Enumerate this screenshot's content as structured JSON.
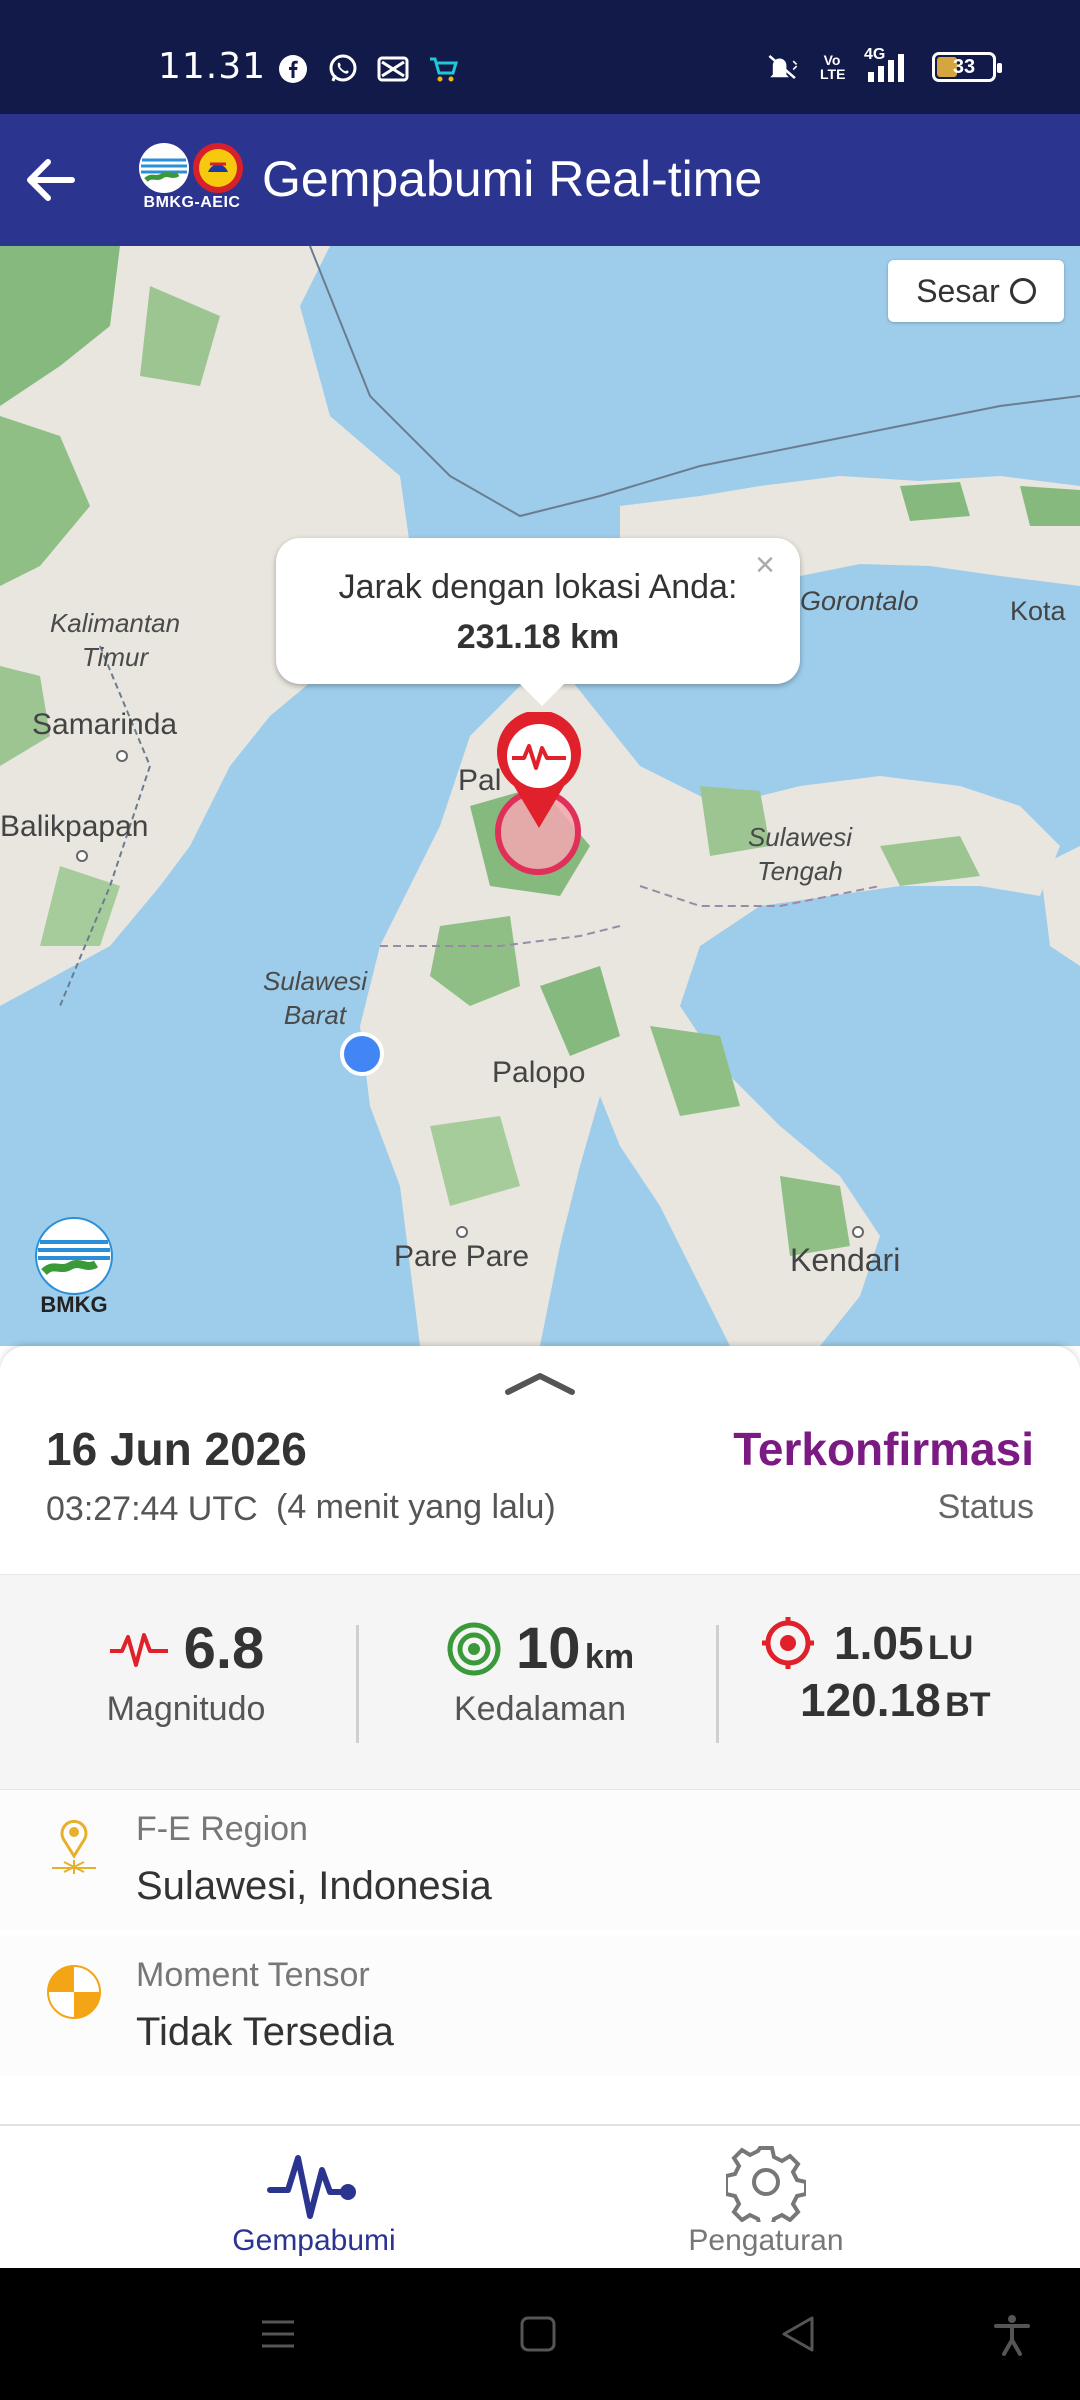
{
  "status_bar": {
    "time": "11.31",
    "left_icons": [
      "facebook-icon",
      "whatsapp-icon",
      "capcut-icon",
      "shop-cart-icon"
    ],
    "right_icons": [
      "mute-vibrate-icon",
      "volte-icon",
      "signal-4g-icon",
      "battery-icon"
    ],
    "volte": "Vo LTE",
    "network": "4G",
    "battery": "33"
  },
  "app_bar": {
    "title": "Gempabumi Real-time",
    "logo_text": "BMKG-AEIC",
    "back_icon": "arrow-back-icon"
  },
  "map": {
    "sesar_label": "Sesar",
    "popup": {
      "line1": "Jarak dengan lokasi Anda:",
      "distance": "231.18 km",
      "close": "×"
    },
    "labels": {
      "kalimantan_timur": "Kalimantan Timur",
      "samarinda": "Samarinda",
      "balikpapan": "Balikpapan",
      "sulawesi_barat": "Sulawesi Barat",
      "sulawesi_tengah": "Sulawesi Tengah",
      "gorontalo": "Gorontalo",
      "kota": "Kota",
      "palu": "Pal",
      "palopo": "Palopo",
      "pare_pare": "Pare Pare",
      "kendari": "Kendari"
    },
    "bmkg_text": "BMKG"
  },
  "event": {
    "date": "16 Jun 2026",
    "time_utc": "03:27:44 UTC",
    "time_ago": "(4 menit yang lalu)",
    "status_value": "Terkonfirmasi",
    "status_label": "Status",
    "magnitude": "6.8",
    "magnitude_label": "Magnitudo",
    "depth": "10",
    "depth_unit": "km",
    "depth_label": "Kedalaman",
    "lat": "1.05",
    "lat_unit": "LU",
    "lon": "120.18",
    "lon_unit": "BT",
    "region_label": "F-E Region",
    "region_value": "Sulawesi, Indonesia",
    "tensor_label": "Moment Tensor",
    "tensor_value": "Tidak Tersedia"
  },
  "bottom_nav": {
    "items": [
      {
        "label": "Gempabumi",
        "icon": "seismograph-icon",
        "active": true,
        "color": "#2b3590"
      },
      {
        "label": "Pengaturan",
        "icon": "gear-icon",
        "active": false,
        "color": "#777777"
      }
    ]
  },
  "colors": {
    "appbar": "#2b3590",
    "statusbar": "#121a4a",
    "status_confirmed": "#7b1a82",
    "quake_red": "#e0202a",
    "depth_green": "#3a9a3a"
  }
}
